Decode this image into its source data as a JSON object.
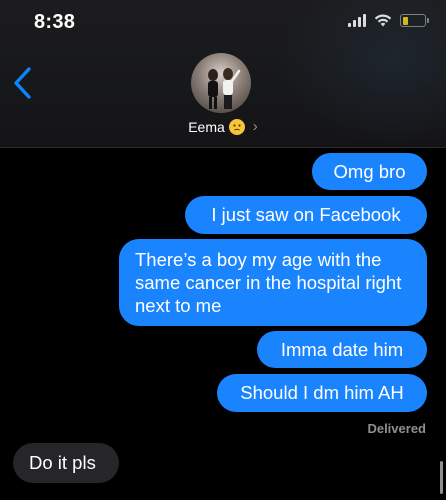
{
  "status_bar": {
    "time": "8:38"
  },
  "contact": {
    "name": "Eema"
  },
  "messages": [
    {
      "direction": "out",
      "text": "Omg bro"
    },
    {
      "direction": "out",
      "text": "I just saw on Facebook"
    },
    {
      "direction": "out",
      "text": "There’s a boy my age with the same cancer in the hospital right next to me"
    },
    {
      "direction": "out",
      "text": "Imma date him"
    },
    {
      "direction": "out",
      "text": "Should I dm him AH"
    },
    {
      "direction": "in",
      "text": "Do it pls"
    }
  ],
  "delivery_status": "Delivered",
  "colors": {
    "outgoing": "#1a84ff",
    "incoming": "#262628",
    "accent": "#0a84ff",
    "battery": "#ffd60a"
  },
  "icons": [
    "back-chevron-icon",
    "cellular-signal-icon",
    "wifi-icon",
    "battery-icon",
    "chevron-right-icon",
    "emoji-icon"
  ]
}
